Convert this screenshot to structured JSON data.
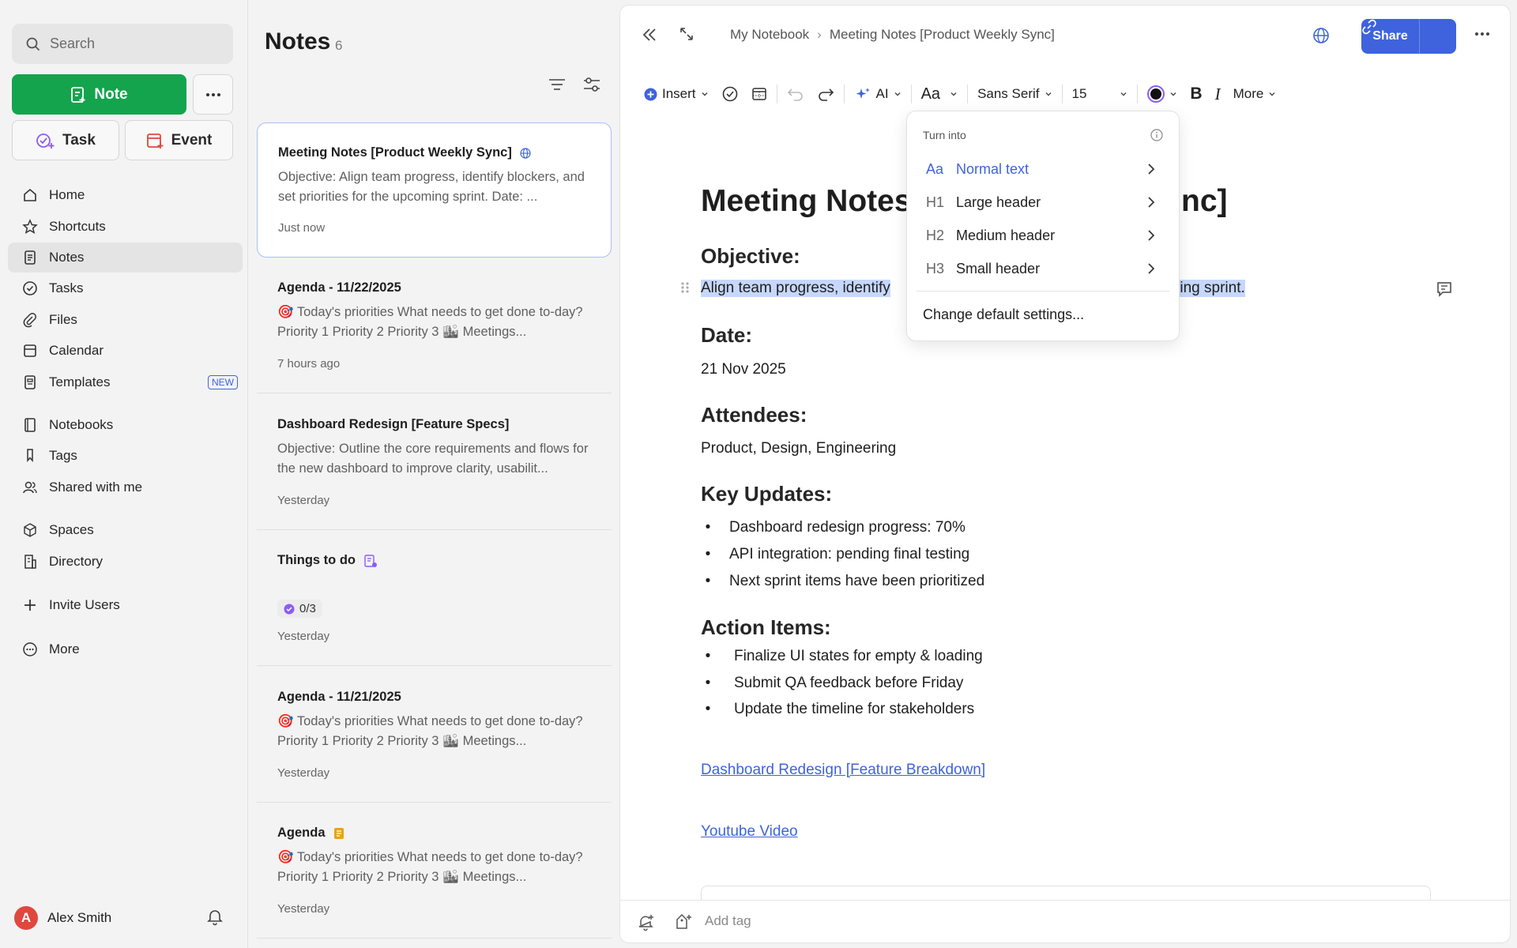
{
  "sidebar": {
    "search_placeholder": "Search",
    "note_button": "Note",
    "task_button": "Task",
    "event_button": "Event",
    "nav": [
      {
        "label": "Home",
        "icon": "home-icon"
      },
      {
        "label": "Shortcuts",
        "icon": "star-icon"
      },
      {
        "label": "Notes",
        "icon": "note-icon",
        "active": true
      },
      {
        "label": "Tasks",
        "icon": "check-circle-icon"
      },
      {
        "label": "Files",
        "icon": "paperclip-icon"
      },
      {
        "label": "Calendar",
        "icon": "calendar-icon"
      },
      {
        "label": "Templates",
        "icon": "template-icon",
        "badge": "NEW"
      },
      {
        "label": "Notebooks",
        "icon": "notebook-icon"
      },
      {
        "label": "Tags",
        "icon": "tag-icon"
      },
      {
        "label": "Shared with me",
        "icon": "people-icon"
      },
      {
        "label": "Spaces",
        "icon": "cube-icon"
      },
      {
        "label": "Directory",
        "icon": "building-icon"
      },
      {
        "label": "Invite Users",
        "icon": "plus-icon"
      },
      {
        "label": "More",
        "icon": "more-circle-icon"
      }
    ],
    "user": {
      "initial": "A",
      "name": "Alex Smith"
    }
  },
  "notes": {
    "title": "Notes",
    "count": "6",
    "items": [
      {
        "title": "Meeting Notes [Product Weekly Sync]",
        "snippet": "Objective: Align team progress, identify blockers, and set priorities for the upcoming sprint. Date: ...",
        "time": "Just now"
      },
      {
        "title": "Agenda - 11/22/2025",
        "snippet": "🎯 Today's priorities What needs to get done to-day? Priority 1 Priority 2 Priority 3 🏙 Meetings...",
        "time": "7 hours ago"
      },
      {
        "title": "Dashboard Redesign [Feature Specs]",
        "snippet": "Objective: Outline the core requirements and flows for the new dashboard to improve clarity, usabilit...",
        "time": "Yesterday"
      },
      {
        "title": "Things to do",
        "task_progress": "0/3",
        "time": "Yesterday"
      },
      {
        "title": "Agenda - 11/21/2025",
        "snippet": "🎯 Today's priorities What needs to get done to-day? Priority 1 Priority 2 Priority 3 🏙 Meetings...",
        "time": "Yesterday"
      },
      {
        "title": "Agenda",
        "snippet": "🎯 Today's priorities What needs to get done to-day? Priority 1 Priority 2 Priority 3 🏙 Meetings...",
        "time": "Yesterday"
      }
    ]
  },
  "editor": {
    "breadcrumb": [
      "My Notebook",
      "Meeting Notes [Product Weekly Sync]"
    ],
    "share_label": "Share",
    "toolbar": {
      "insert": "Insert",
      "ai": "AI",
      "text_style": "Aa",
      "font": "Sans Serif",
      "size": "15",
      "more": "More"
    },
    "doc": {
      "title_left": "Meeting Notes",
      "title_right": "nc]",
      "objective_h": "Objective:",
      "objective_left": "Align team progress, identify",
      "objective_right": "oming sprint.",
      "date_h": "Date:",
      "date": "21 Nov 2025",
      "attendees_h": "Attendees:",
      "attendees": "Product, Design, Engineering",
      "updates_h": "Key Updates:",
      "updates": [
        "Dashboard redesign progress: 70%",
        "API integration: pending final testing",
        "Next sprint items have been prioritized"
      ],
      "actions_h": "Action Items:",
      "actions": [
        "Finalize UI states for empty & loading",
        "Submit QA feedback before Friday",
        "Update the timeline for stakeholders"
      ],
      "link1": "Dashboard Redesign [Feature Breakdown]",
      "link2": "Youtube Video"
    },
    "menu": {
      "header": "Turn into",
      "items": [
        {
          "icon": "Aa",
          "label": "Normal text"
        },
        {
          "icon": "H1",
          "label": "Large header"
        },
        {
          "icon": "H2",
          "label": "Medium header"
        },
        {
          "icon": "H3",
          "label": "Small header"
        }
      ],
      "settings": "Change default settings..."
    },
    "footer": {
      "tag_placeholder": "Add tag"
    }
  },
  "colors": {
    "accent": "#3e63dd",
    "note_green": "#14a44d",
    "highlight": "#c6d7fb"
  }
}
